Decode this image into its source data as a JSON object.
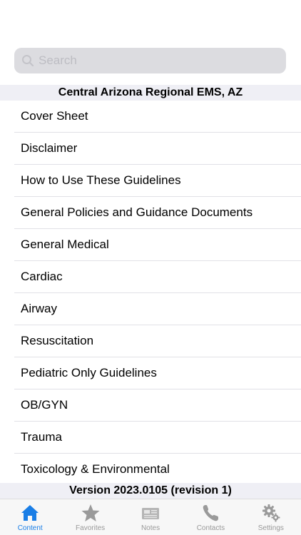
{
  "search": {
    "placeholder": "Search"
  },
  "section_header": "Central Arizona Regional EMS, AZ",
  "items": [
    "Cover Sheet",
    "Disclaimer",
    "How to Use These Guidelines",
    "General Policies and Guidance Documents",
    "General Medical",
    "Cardiac",
    "Airway",
    "Resuscitation",
    "Pediatric Only Guidelines",
    "OB/GYN",
    "Trauma",
    "Toxicology & Environmental"
  ],
  "version": "Version 2023.0105 (revision 1)",
  "tabs": [
    {
      "label": "Content",
      "icon": "home-icon",
      "active": true
    },
    {
      "label": "Favorites",
      "icon": "star-icon",
      "active": false
    },
    {
      "label": "Notes",
      "icon": "notes-icon",
      "active": false
    },
    {
      "label": "Contacts",
      "icon": "phone-icon",
      "active": false
    },
    {
      "label": "Settings",
      "icon": "gear-icon",
      "active": false
    }
  ],
  "colors": {
    "accent": "#1a7ee6",
    "inactive": "#999999",
    "header_bg": "#efeff5",
    "search_bg": "#dcdce0"
  }
}
